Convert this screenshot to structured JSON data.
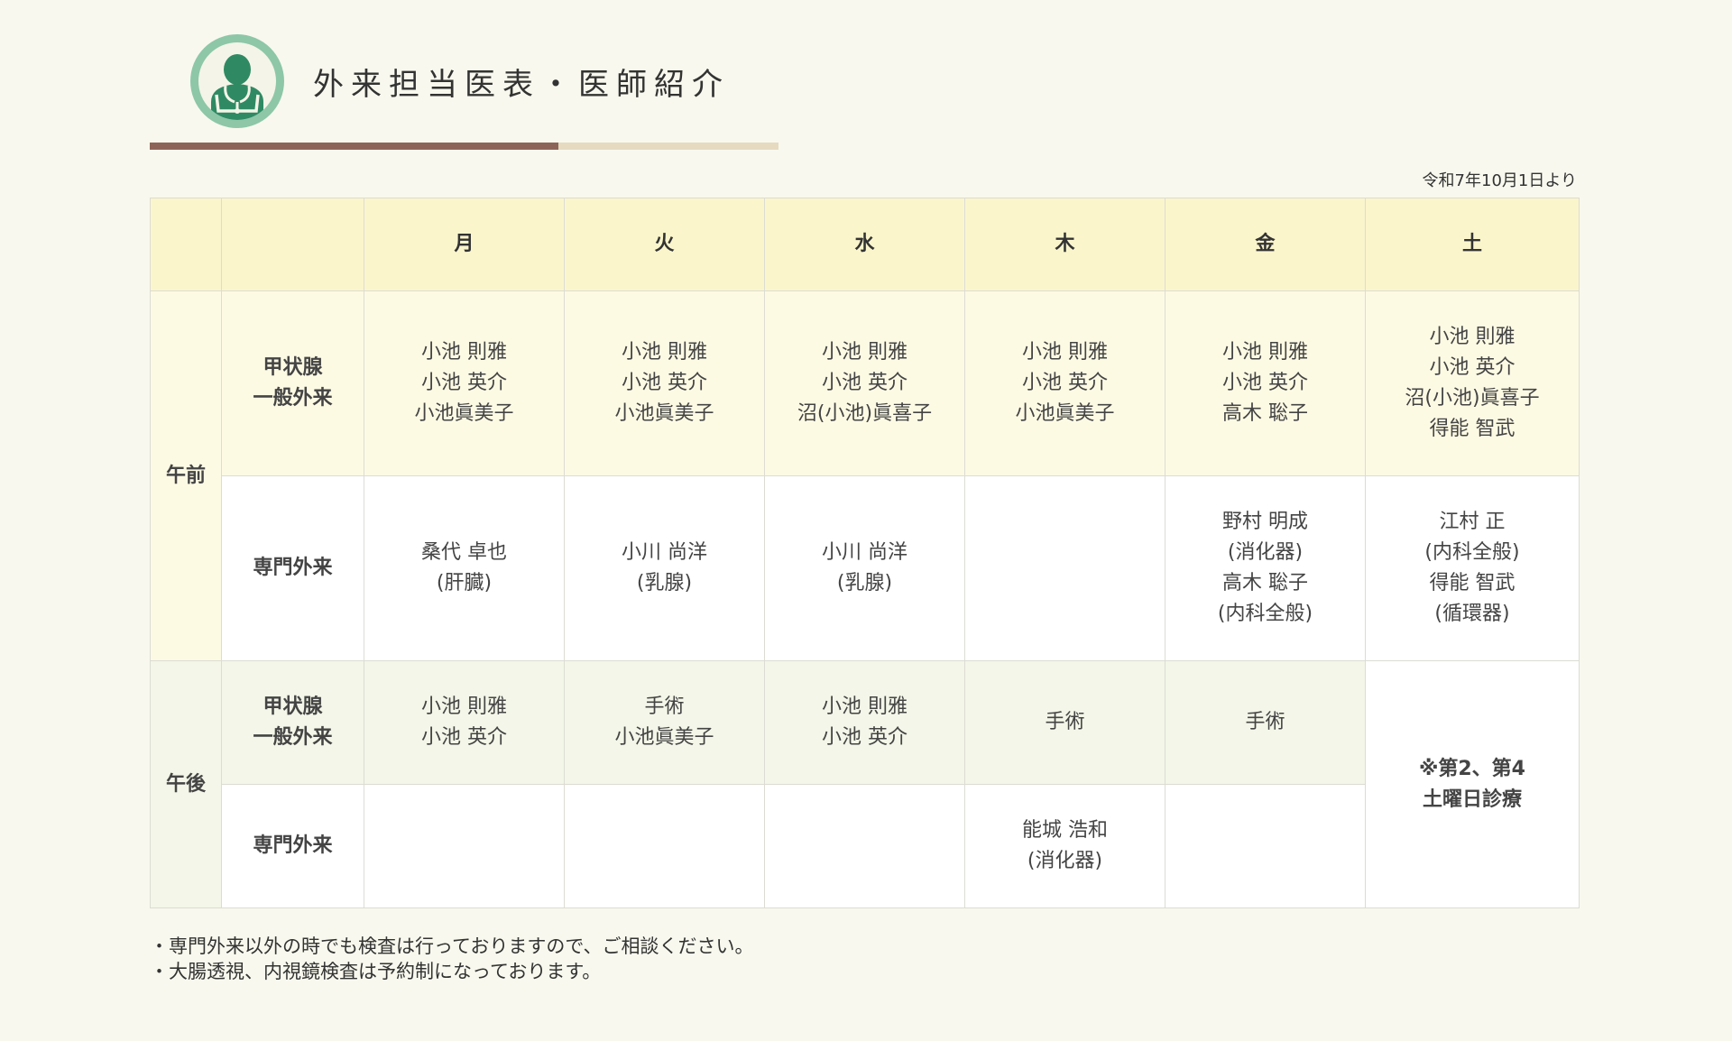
{
  "header": {
    "title": "外来担当医表・医師紹介",
    "icon": "doctor-icon"
  },
  "effective_date": "令和7年10月1日より",
  "colors": {
    "background": "#f8f8ee",
    "accent_brown": "#8d6558",
    "accent_beige": "#e6dac0",
    "logo_green": "#8dc7a8",
    "header_yellow": "#fbf5cc",
    "note_green": "#2e8b57"
  },
  "table": {
    "days": [
      "月",
      "火",
      "水",
      "木",
      "金",
      "土"
    ],
    "am": {
      "label": "午前",
      "general": {
        "label": [
          "甲状腺",
          "一般外来"
        ],
        "cells": [
          [
            "小池 則雅",
            "小池 英介",
            "小池眞美子"
          ],
          [
            "小池 則雅",
            "小池 英介",
            "小池眞美子"
          ],
          [
            "小池 則雅",
            "小池 英介",
            "沼(小池)眞喜子"
          ],
          [
            "小池 則雅",
            "小池 英介",
            "小池眞美子"
          ],
          [
            "小池 則雅",
            "小池 英介",
            "高木 聡子"
          ],
          [
            "小池 則雅",
            "小池 英介",
            "沼(小池)眞喜子",
            "得能 智武"
          ]
        ]
      },
      "special": {
        "label": "専門外来",
        "cells": [
          [
            "桑代 卓也",
            "(肝臓)"
          ],
          [
            "小川 尚洋",
            "(乳腺)"
          ],
          [
            "小川 尚洋",
            "(乳腺)"
          ],
          [],
          [
            "野村 明成",
            "(消化器)",
            "高木 聡子",
            "(内科全般)"
          ],
          [
            "江村 正",
            "(内科全般)",
            "得能 智武",
            "(循環器)"
          ]
        ]
      }
    },
    "pm": {
      "label": "午後",
      "general": {
        "label": [
          "甲状腺",
          "一般外来"
        ],
        "cells": [
          [
            "小池 則雅",
            "小池 英介"
          ],
          [
            "手術",
            "小池眞美子"
          ],
          [
            "小池 則雅",
            "小池 英介"
          ],
          [
            "手術"
          ],
          [
            "手術"
          ]
        ]
      },
      "special": {
        "label": "専門外来",
        "cells": [
          [],
          [],
          [],
          [
            "能城 浩和",
            "(消化器)"
          ],
          []
        ]
      },
      "saturday_note": [
        "※第2、第4",
        "土曜日診療"
      ]
    }
  },
  "notes": [
    "・専門外来以外の時でも検査は行っておりますので、ご相談ください。",
    "・大腸透視、内視鏡検査は予約制になっております。"
  ]
}
